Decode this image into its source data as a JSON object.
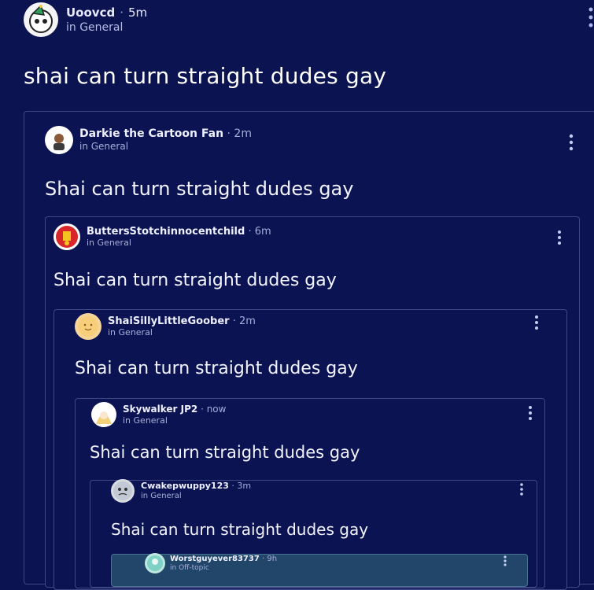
{
  "post": {
    "username": "Uoovcd",
    "time": "5m",
    "location": "in General",
    "title": "shai can turn straight dudes gay"
  },
  "quotes": [
    {
      "username": "Darkie the Cartoon Fan",
      "time": "2m",
      "location": "in General",
      "text": "Shai can turn straight dudes gay",
      "avatar_icon": "cartoon-avatar-icon"
    },
    {
      "username": "ButtersStotchinnocentchild",
      "time": "6m",
      "location": "in General",
      "text": "Shai can turn straight dudes gay",
      "avatar_icon": "red-badge-avatar-icon"
    },
    {
      "username": "ShaiSillyLittleGoober",
      "time": "2m",
      "location": "in General",
      "text": "Shai can turn straight dudes gay",
      "avatar_icon": "sun-avatar-icon"
    },
    {
      "username": "Skywalker JP2",
      "time": "now",
      "location": "in General",
      "text": "Shai can turn straight dudes gay",
      "avatar_icon": "anime-avatar-icon"
    },
    {
      "username": "Cwakepwuppy123",
      "time": "3m",
      "location": "in General",
      "text": "Shai can turn straight dudes gay",
      "avatar_icon": "grey-avatar-icon"
    },
    {
      "username": "Worstguyever83737",
      "time": "9h",
      "location": "in Off-topic",
      "text": "",
      "avatar_icon": "teal-avatar-icon"
    }
  ],
  "colors": {
    "background": "#0b1450",
    "card_border": "#5a63a8",
    "text": "#ffffff"
  }
}
